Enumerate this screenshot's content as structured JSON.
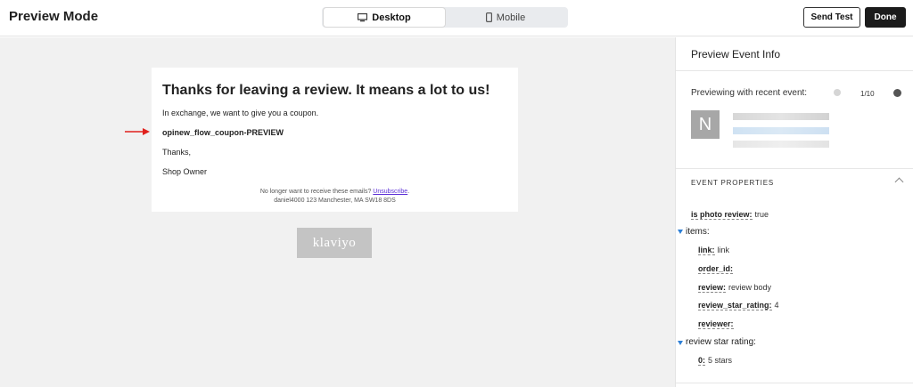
{
  "header": {
    "title": "Preview Mode",
    "tabs": [
      {
        "label": "Desktop",
        "icon": "monitor-icon",
        "active": true
      },
      {
        "label": "Mobile",
        "icon": "phone-icon",
        "active": false
      }
    ],
    "send_test_label": "Send Test",
    "done_label": "Done"
  },
  "email": {
    "heading": "Thanks for leaving a review. It means a lot to us!",
    "line1": "In exchange, we want to give you a coupon.",
    "coupon_code": "opinew_flow_coupon-PREVIEW",
    "thanks": "Thanks,",
    "signature": "Shop Owner",
    "footer_prefix": "No longer want to receive these emails?",
    "unsubscribe": "Unsubscribe",
    "footer_suffix": ".",
    "address": "daniel4000 123 Manchester, MA SW18 8DS",
    "brand": "klaviyo"
  },
  "panel": {
    "title": "Preview Event Info",
    "recent_label": "Previewing with recent event:",
    "pager": "1/10",
    "avatar_letter": "N",
    "props_header": "EVENT PROPERTIES",
    "properties": {
      "is_photo_review_key": "is photo review:",
      "is_photo_review_val": "true",
      "items_key": "items:",
      "link_key": "link:",
      "link_val": "link",
      "order_id_key": "order_id:",
      "review_key": "review:",
      "review_val": "review body",
      "review_star_rating_key": "review_star_rating:",
      "review_star_rating_val": "4",
      "reviewer_key": "reviewer:",
      "group_star_key": "review star rating:",
      "zero_key": "0:",
      "zero_val": "5 stars"
    }
  },
  "colors": {
    "accent_blue": "#2d7fd6",
    "arrow_red": "#e0201c",
    "done_bg": "#1b1b1b",
    "link_purple": "#5b2fd6"
  }
}
